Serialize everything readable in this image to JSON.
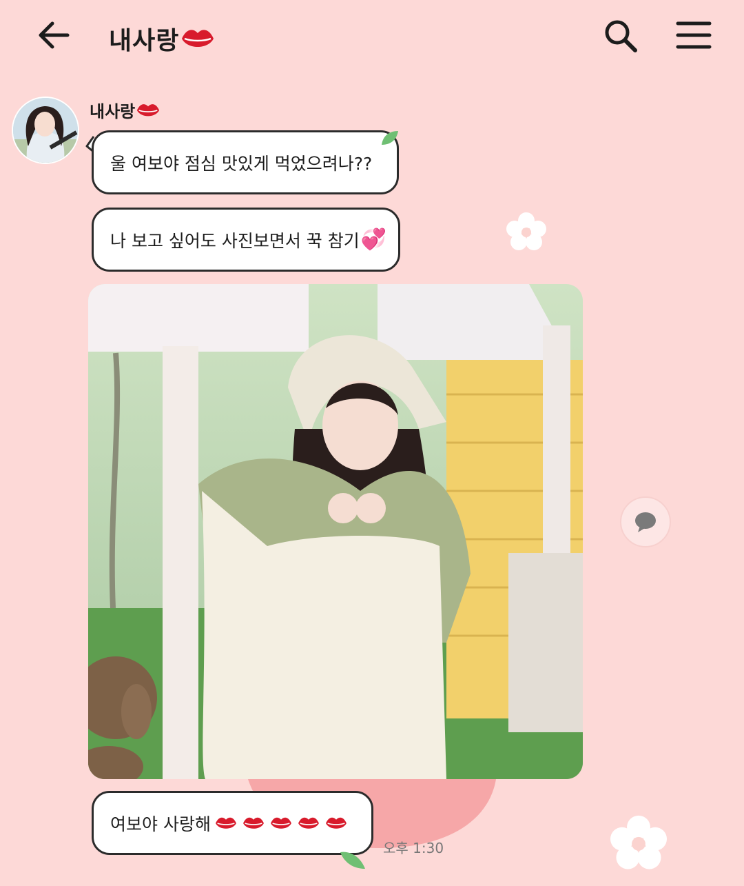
{
  "header": {
    "title": "내사랑",
    "back_icon": "arrow-left-icon",
    "search_icon": "search-icon",
    "menu_icon": "hamburger-menu-icon"
  },
  "chat": {
    "sender_name": "내사랑",
    "messages": [
      {
        "text": "울 여보야 점심 맛있게 먹었으려나??"
      },
      {
        "text": "나 보고 싶어도 사진보면서 꾹 참기",
        "emoji": "💞"
      },
      {
        "type": "image",
        "description_icon": "photo"
      },
      {
        "text": "여보야 사랑해"
      }
    ],
    "time": "오후 1:30"
  },
  "colors": {
    "background": "#fdd9d7",
    "bubble": "#ffffff",
    "bubble_border": "#2b2b2b",
    "lips": "#d81b2c",
    "leaf": "#6fbf73"
  }
}
